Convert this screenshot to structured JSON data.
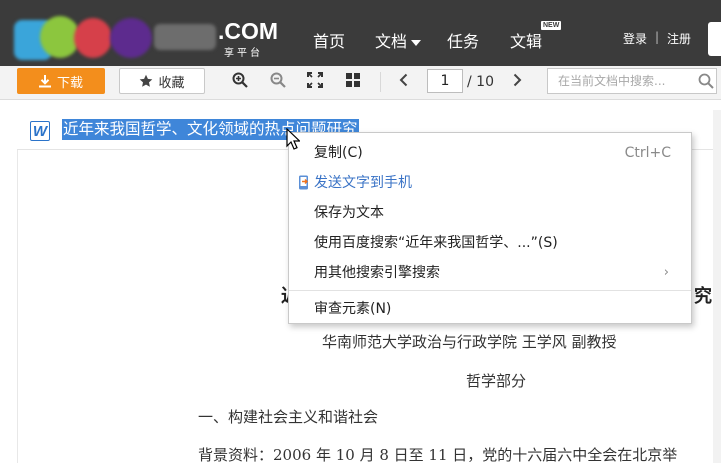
{
  "header": {
    "logo_suffix": ".COM",
    "logo_sub": "享平台",
    "nav": [
      "首页",
      "文档",
      "任务",
      "文辑"
    ],
    "new_badge": "NEW",
    "login": "登录",
    "separator": "|",
    "register": "注册"
  },
  "toolbar": {
    "download_label": "下载",
    "favorite_label": "收藏",
    "page_current": "1",
    "page_total": "/ 10",
    "search_placeholder": "在当前文档中搜索..."
  },
  "document": {
    "title": "近年来我国哲学、文化领域的热点问题研究",
    "heading_left": "近",
    "heading_right": "究",
    "author": "华南师范大学政治与行政学院   王学风   副教授",
    "section": "哲学部分",
    "h1": "一、构建社会主义和谐社会",
    "para": "背景资料：2006 年 10 月 8 日至 11 日，党的十六届六中全会在北京举"
  },
  "context_menu": {
    "copy": "复制(C)",
    "copy_shortcut": "Ctrl+C",
    "send_to_phone": "发送文字到手机",
    "save_as_text": "保存为文本",
    "baidu_search": "使用百度搜索“近年来我国哲学、...”(S)",
    "other_search": "用其他搜索引擎搜索",
    "inspect": "审查元素(N)"
  },
  "colors": {
    "topbar": "#3b3b3b",
    "download_button": "#f38e1c",
    "selection": "#3f86d9",
    "link_blue": "#3a73c6"
  }
}
